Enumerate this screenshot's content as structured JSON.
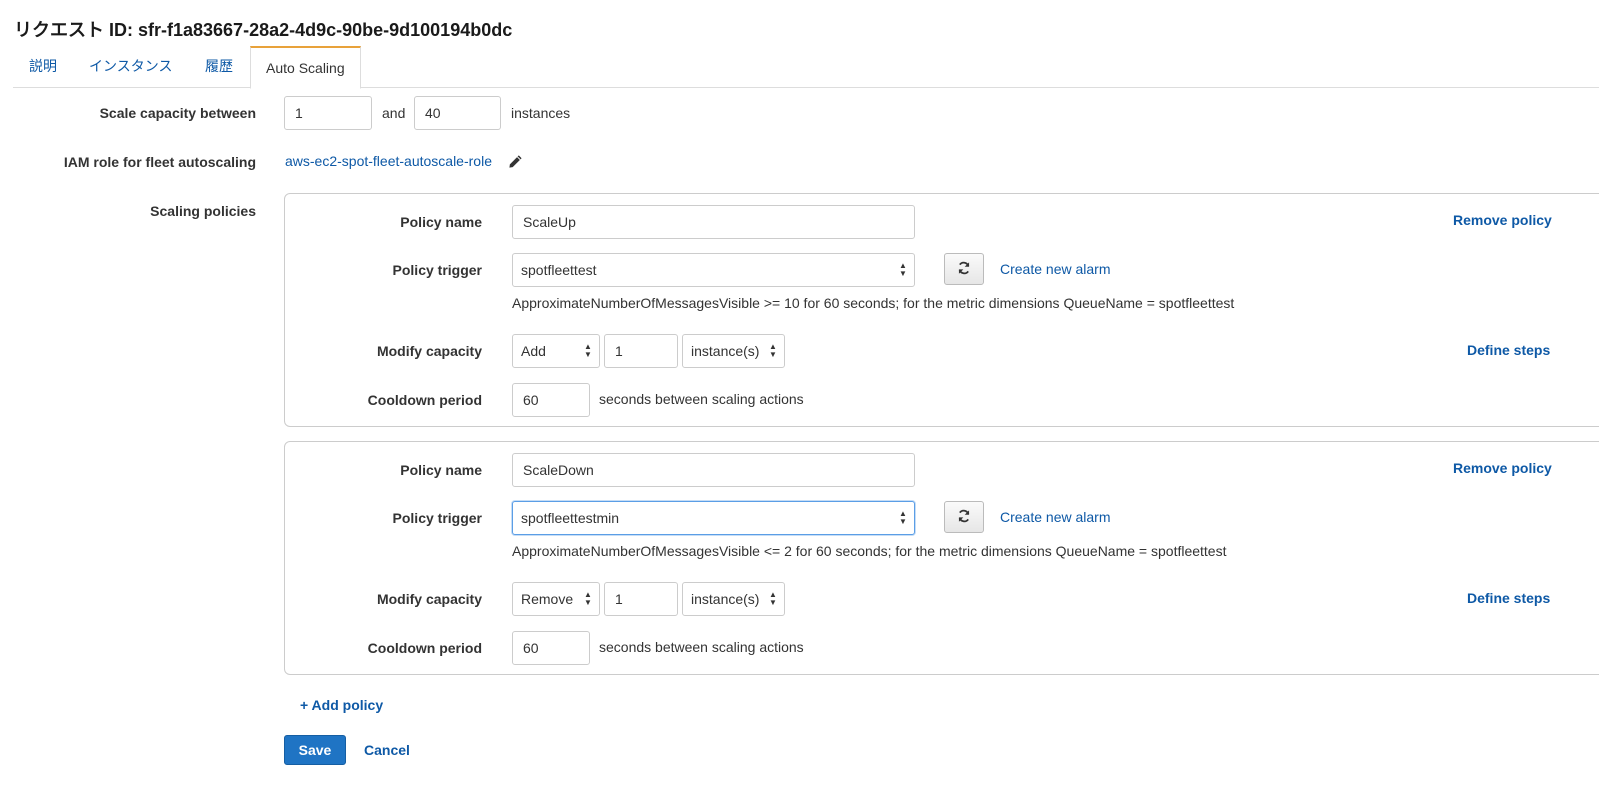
{
  "header": {
    "title": "リクエスト ID: sfr-f1a83667-28a2-4d9c-90be-9d100194b0dc"
  },
  "tabs": [
    {
      "label": "説明"
    },
    {
      "label": "インスタンス"
    },
    {
      "label": "履歴"
    },
    {
      "label": "Auto Scaling",
      "active": true
    }
  ],
  "capacity": {
    "label": "Scale capacity between",
    "min": "1",
    "and_text": "and",
    "max": "40",
    "unit": "instances"
  },
  "iam": {
    "label": "IAM role for fleet autoscaling",
    "role": "aws-ec2-spot-fleet-autoscale-role",
    "edit_icon": "pencil-icon"
  },
  "scaling_policies": {
    "label": "Scaling policies",
    "policies": [
      {
        "name_label": "Policy name",
        "name": "ScaleUp",
        "remove_label": "Remove policy",
        "trigger_label": "Policy trigger",
        "trigger": "spotfleettest",
        "create_alarm": "Create new alarm",
        "description": "ApproximateNumberOfMessagesVisible >= 10 for 60 seconds; for the metric dimensions QueueName = spotfleettest",
        "modify_label": "Modify capacity",
        "action": "Add",
        "amount": "1",
        "unit": "instance(s)",
        "define_steps": "Define steps",
        "cooldown_label": "Cooldown period",
        "cooldown": "60",
        "cooldown_suffix": "seconds between scaling actions"
      },
      {
        "name_label": "Policy name",
        "name": "ScaleDown",
        "remove_label": "Remove policy",
        "trigger_label": "Policy trigger",
        "trigger": "spotfleettestmin",
        "create_alarm": "Create new alarm",
        "description": "ApproximateNumberOfMessagesVisible <= 2 for 60 seconds; for the metric dimensions QueueName = spotfleettest",
        "modify_label": "Modify capacity",
        "action": "Remove",
        "amount": "1",
        "unit": "instance(s)",
        "define_steps": "Define steps",
        "cooldown_label": "Cooldown period",
        "cooldown": "60",
        "cooldown_suffix": "seconds between scaling actions"
      }
    ],
    "add_policy": "+ Add policy"
  },
  "footer": {
    "save": "Save",
    "cancel": "Cancel"
  },
  "colors": {
    "link": "#0e59a6",
    "primary_button": "#1f74c4",
    "active_tab_accent": "#e8a23a"
  }
}
